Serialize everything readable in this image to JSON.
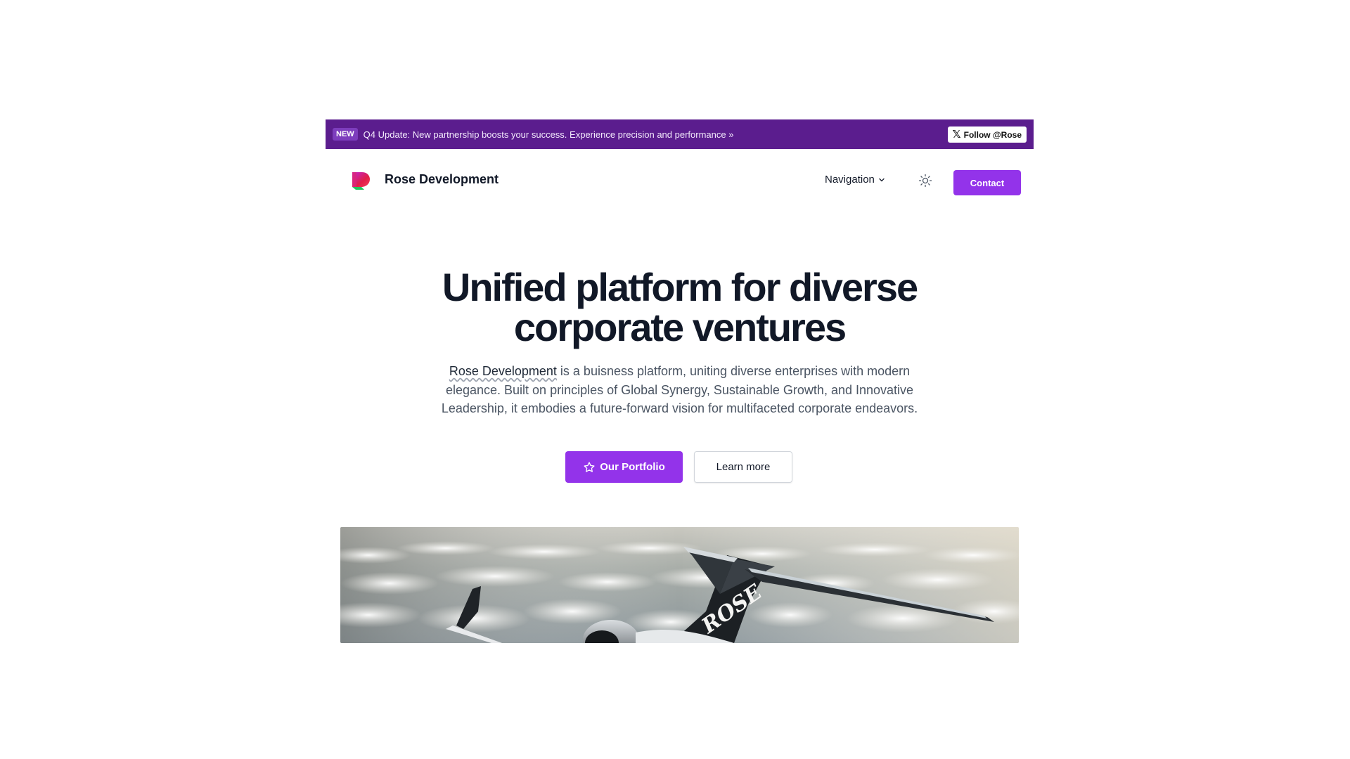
{
  "banner": {
    "badge": "NEW",
    "text": "Q4 Update: New partnership boosts your success. Experience precision and performance »",
    "follow_label": "Follow @Rose"
  },
  "header": {
    "brand_name": "Rose Development",
    "nav_label": "Navigation",
    "contact_label": "Contact"
  },
  "hero": {
    "title_line1": "Unified platform for diverse",
    "title_line2": "corporate ventures",
    "desc_link": "Rose Development",
    "desc_rest": " is a buisness platform, uniting diverse enterprises with modern elegance. Built on principles of Global Synergy, Sustainable Growth, and Innovative Leadership, it embodies a future-forward vision for multifaceted corporate endeavors.",
    "portfolio_label": "Our Portfolio",
    "learn_label": "Learn more",
    "image_text": "ROSE"
  },
  "colors": {
    "banner_bg": "#5b1d8e",
    "accent": "#9333ea",
    "heading": "#111827",
    "body_text": "#4b5563"
  },
  "icons": {
    "follow": "x-logo-icon",
    "nav": "chevron-down-icon",
    "theme": "sun-icon",
    "portfolio": "star-icon"
  }
}
